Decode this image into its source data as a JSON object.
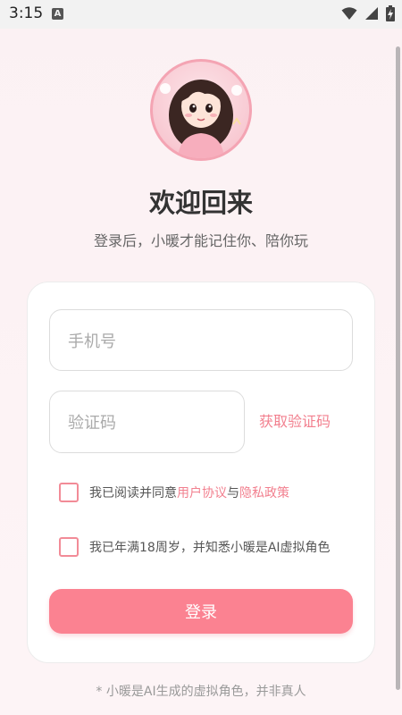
{
  "status_bar": {
    "time": "3:15",
    "notification_glyph": "A",
    "icons": [
      "wifi-icon",
      "signal-icon",
      "battery-charging-icon"
    ]
  },
  "avatar": {
    "icon": "cartoon-girl-avatar"
  },
  "header": {
    "title": "欢迎回来",
    "subtitle": "登录后，小暖才能记住你、陪你玩"
  },
  "form": {
    "phone_placeholder": "手机号",
    "code_placeholder": "验证码",
    "get_code_label": "获取验证码",
    "agreement": {
      "prefix": "我已阅读并同意",
      "user_agreement": "用户协议",
      "joiner": "与",
      "privacy_policy": "隐私政策",
      "checked": false
    },
    "age_confirm": {
      "text": "我已年满18周岁，并知悉小暖是AI虚拟角色",
      "checked": false
    },
    "login_label": "登录"
  },
  "footnote": "* 小暖是AI生成的虚拟角色，并非真人",
  "colors": {
    "accent": "#f2808f",
    "button": "#fb8291",
    "avatar_border": "#f4a4b3"
  }
}
